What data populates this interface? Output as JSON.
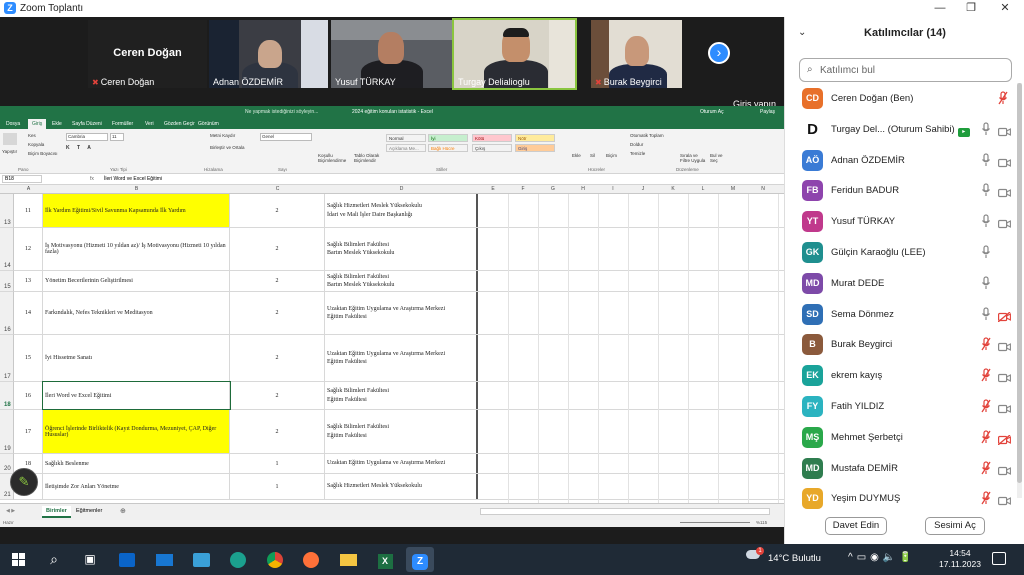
{
  "window": {
    "title": "Zoom Toplantı"
  },
  "video_tiles": [
    {
      "name": "Ceren Doğan",
      "big_name": "Ceren Doğan",
      "muted": true
    },
    {
      "name": "Adnan ÖZDEMİR",
      "muted": false
    },
    {
      "name": "Yusuf TÜRKAY",
      "muted": false
    },
    {
      "name": "Turgay Delialioglu",
      "muted": false,
      "speaking": true
    },
    {
      "name": "Burak Beygirci",
      "muted": true
    }
  ],
  "signin_label": "Giriş yapın",
  "excel": {
    "title": "2024 eğitim konuları istatistik - Excel",
    "search_hint": "Ne yapmak istediğinizi söyleyin...",
    "user": "Oturum Aç",
    "share": "Paylaş",
    "tabs": [
      "Dosya",
      "Giriş",
      "Ekle",
      "Sayfa Düzeni",
      "Formüller",
      "Veri",
      "Gözden Geçir",
      "Görünüm"
    ],
    "active_tab": "Giriş",
    "ribbon": {
      "paste": "Yapıştır",
      "cut": "Kes",
      "copy": "Kopyala",
      "format_painter": "Biçim Boyacısı",
      "font": "Cambria",
      "font_size": "11",
      "wrap": "Metni Kaydır",
      "merge": "Birleştir ve Ortala",
      "number_format": "Genel",
      "cond_format": "Koşullu Biçimlendirme",
      "table_format": "Tablo Olarak Biçimlendir",
      "styles": [
        {
          "label": "Normal",
          "bg": "#ffffff",
          "fg": "#222222"
        },
        {
          "label": "İyi",
          "bg": "#c6efce",
          "fg": "#006100"
        },
        {
          "label": "Kötü",
          "bg": "#ffc7ce",
          "fg": "#9c0006"
        },
        {
          "label": "Nötr",
          "bg": "#ffeb9c",
          "fg": "#9c5700"
        },
        {
          "label": "Açıklama Me...",
          "bg": "#ffffff",
          "fg": "#7f7f7f"
        },
        {
          "label": "Bağlı Hücre",
          "bg": "#ffffff",
          "fg": "#fa7d00"
        },
        {
          "label": "Çıkış",
          "bg": "#f2f2f2",
          "fg": "#3f3f3f"
        },
        {
          "label": "Giriş",
          "bg": "#ffcc99",
          "fg": "#3f3f76"
        }
      ],
      "insert": "Ekle",
      "delete": "Sil",
      "format": "Biçim",
      "autosum": "Otomatik Toplam",
      "fill": "Doldur",
      "clear": "Temizle",
      "sort": "Sırala ve Filtre Uygula",
      "find": "Bul ve Seç",
      "groups": [
        "Pano",
        "Yazı Tipi",
        "Hizalama",
        "Sayı",
        "Stiller",
        "Hücreler",
        "Düzenleme"
      ]
    },
    "name_box": "B18",
    "fx": "fx",
    "formula": "İleri Word ve Excel Eğitimi",
    "columns": [
      "A",
      "B",
      "C",
      "D",
      "E",
      "F",
      "G",
      "H",
      "I",
      "J",
      "K",
      "L",
      "M",
      "N"
    ],
    "rows": [
      {
        "row_num": "13",
        "a": "11",
        "b": "İlk Yardım Eğitimi/Sivil Savunma Kapsamında İlk Yardım",
        "c": "2",
        "d": [
          "Sağlık Hizmetleri Meslek Yüksekokulu",
          "İdari ve Mali İşler Daire Başkanlığı"
        ],
        "yellow": true
      },
      {
        "row_num": "14",
        "a": "12",
        "b": "İş Motivasyonu (Hizmeti 10 yıldan az)/ İş Motivasyonu (Hizmeti 10 yıldan fazla)",
        "c": "2",
        "d": [
          "Sağlık Bilimleri Fakültesi",
          "Bartın Meslek Yüksekokulu"
        ],
        "yellow": false
      },
      {
        "row_num": "15",
        "a": "13",
        "b": "Yönetim Becerilerinin Geliştirilmesi",
        "c": "2",
        "d": [
          "Sağlık Bilimleri Fakültesi",
          "Bartın Meslek Yüksekokulu"
        ],
        "yellow": false
      },
      {
        "row_num": "16",
        "a": "14",
        "b": "Farkındalık, Nefes Teknikleri ve Meditasyon",
        "c": "2",
        "d": [
          "Uzaktan Eğitim Uygulama ve Araştırma Merkezi",
          "Eğitim Fakültesi"
        ],
        "yellow": false
      },
      {
        "row_num": "17",
        "a": "15",
        "b": "İyi Hissetme Sanatı",
        "c": "2",
        "d": [
          "Uzaktan Eğitim Uygulama ve Araştırma Merkezi",
          "Eğitim Fakültesi"
        ],
        "yellow": false
      },
      {
        "row_num": "18",
        "a": "16",
        "b": "İleri Word ve Excel Eğitimi",
        "c": "2",
        "d": [
          "Sağlık Bilimleri Fakültesi",
          "Eğitim Fakültesi"
        ],
        "yellow": false,
        "selected": true
      },
      {
        "row_num": "19",
        "a": "17",
        "b": "Öğrenci İşlerinde Birliktelik (Kayıt Dondurma, Mezuniyet, ÇAP, Diğer Hususlar)",
        "c": "2",
        "d": [
          "Sağlık Bilimleri Fakültesi",
          "Eğitim Fakültesi"
        ],
        "yellow": true
      },
      {
        "row_num": "20",
        "a": "18",
        "b": "Sağlıklı Beslenme",
        "c": "1",
        "d": [
          "Uzaktan Eğitim Uygulama ve Araştırma Merkezi"
        ],
        "yellow": false
      },
      {
        "row_num": "21",
        "a": "19",
        "b": "İletişimde Zor Anları Yönetme",
        "c": "1",
        "d": [
          "Sağlık Hizmetleri Meslek Yüksekokulu"
        ],
        "yellow": false
      }
    ],
    "sheets": [
      "Birimler",
      "Eğitmenler"
    ],
    "active_sheet": "Birimler",
    "status_left": "Hazır",
    "zoom": "%115"
  },
  "participants_panel": {
    "title": "Katılımcılar (14)",
    "search_placeholder": "Katılımcı bul",
    "participants": [
      {
        "initials": "CD",
        "name": "Ceren Doğan (Ben)",
        "color": "#e8702a",
        "mic": "muted",
        "cam": "none"
      },
      {
        "initials": "D",
        "name": "Turgay Del... (Oturum Sahibi)",
        "color": "#111111",
        "mic": "on",
        "cam": "on",
        "host": true
      },
      {
        "initials": "AÖ",
        "name": "Adnan ÖZDEMİR",
        "color": "#3a7bd5",
        "mic": "on",
        "cam": "on"
      },
      {
        "initials": "FB",
        "name": "Feridun BADUR",
        "color": "#8e44ad",
        "mic": "on",
        "cam": "on"
      },
      {
        "initials": "YT",
        "name": "Yusuf TÜRKAY",
        "color": "#c0398c",
        "mic": "on",
        "cam": "on"
      },
      {
        "initials": "GK",
        "name": "Gülçin Karaoğlu (LEE)",
        "color": "#1f8f8f",
        "mic": "on",
        "cam": "none"
      },
      {
        "initials": "MD",
        "name": "Murat DEDE",
        "color": "#7d4aa8",
        "mic": "on",
        "cam": "none"
      },
      {
        "initials": "SD",
        "name": "Sema Dönmez",
        "color": "#2f6fb5",
        "mic": "on",
        "cam": "off"
      },
      {
        "initials": "B",
        "name": "Burak Beygirci",
        "color": "#8b5a3c",
        "mic": "muted",
        "cam": "on"
      },
      {
        "initials": "EK",
        "name": "ekrem kayış",
        "color": "#1aa39a",
        "mic": "muted",
        "cam": "on"
      },
      {
        "initials": "FY",
        "name": "Fatih YILDIZ",
        "color": "#2bb3c0",
        "mic": "muted",
        "cam": "on"
      },
      {
        "initials": "MŞ",
        "name": "Mehmet Şerbetçi",
        "color": "#2aa84a",
        "mic": "muted",
        "cam": "off"
      },
      {
        "initials": "MD",
        "name": "Mustafa DEMİR",
        "color": "#2f7d4f",
        "mic": "muted",
        "cam": "on"
      },
      {
        "initials": "YD",
        "name": "Yeşim DUYMUŞ",
        "color": "#e8a82a",
        "mic": "muted",
        "cam": "on"
      }
    ],
    "invite_label": "Davet Edin",
    "unmute_label": "Sesimi Aç"
  },
  "taskbar": {
    "icons": [
      "windows-start",
      "search",
      "task-view",
      "store",
      "mail",
      "photos",
      "edge",
      "chrome",
      "firefox",
      "file-explorer",
      "excel",
      "zoom"
    ],
    "weather_badge": "1",
    "weather": "14°C  Bulutlu",
    "time": "14:54",
    "date": "17.11.2023"
  }
}
